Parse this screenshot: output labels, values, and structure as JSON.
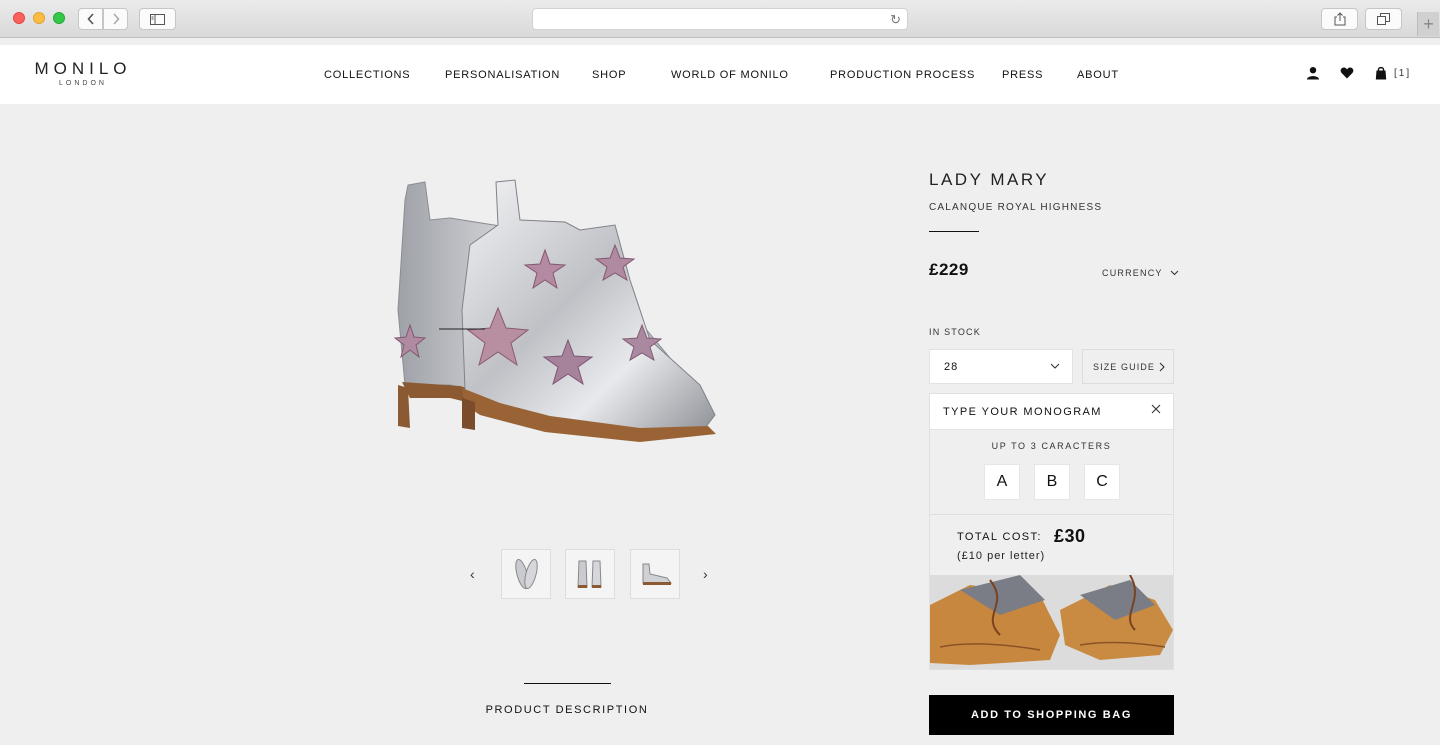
{
  "browser": {
    "back_icon": "chevron-left-icon",
    "forward_icon": "chevron-right-icon",
    "sidebar_icon": "sidebar-icon",
    "reload_icon": "reload-icon",
    "share_icon": "share-icon",
    "tabs_icon": "tabs-icon",
    "newtab_icon": "plus-icon"
  },
  "header": {
    "logo_main": "MONILO",
    "logo_sub": "LONDON",
    "nav": [
      "COLLECTIONS",
      "PERSONALISATION",
      "SHOP",
      "WORLD OF MONILO",
      "PRODUCTION PROCESS",
      "PRESS",
      "ABOUT"
    ],
    "cart_count": "[1]"
  },
  "gallery": {
    "prev_glyph": "‹",
    "next_glyph": "›",
    "thumbnails": [
      "shoe-top-view",
      "shoe-back-view",
      "shoe-side-view"
    ]
  },
  "description": {
    "label": "PRODUCT DESCRIPTION"
  },
  "product": {
    "title": "LADY MARY",
    "subtitle": "CALANQUE ROYAL HIGHNESS",
    "price": "£229",
    "currency_label": "CURRENCY",
    "stock": "IN STOCK",
    "size_value": "28",
    "size_guide_label": "SIZE GUIDE"
  },
  "monogram": {
    "input_placeholder": "TYPE YOUR MONOGRAM",
    "hint": "UP TO 3 CARACTERS",
    "letters": [
      "A",
      "B",
      "C"
    ],
    "total_label": "TOTAL COST:",
    "total_value": "£30",
    "per_letter": "(£10 per letter)"
  },
  "actions": {
    "add_to_bag": "ADD TO SHOPPING BAG"
  },
  "colors": {
    "accent": "#000000",
    "background": "#efefef"
  }
}
